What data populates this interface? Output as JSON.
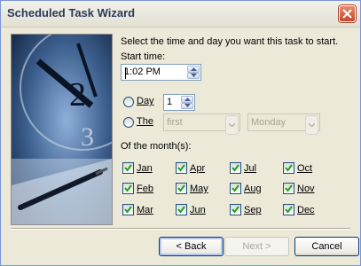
{
  "window": {
    "title": "Scheduled Task Wizard"
  },
  "instruction": "Select the time and day you want this task to start.",
  "start_time": {
    "label": "Start time:",
    "value": "1:02 PM"
  },
  "day_option": {
    "label": "Day",
    "value": "1"
  },
  "the_option": {
    "label": "The",
    "week_value": "first",
    "weekday_value": "Monday"
  },
  "months": {
    "label": "Of the month(s):",
    "items": [
      {
        "label": "Jan",
        "checked": true
      },
      {
        "label": "Apr",
        "checked": true
      },
      {
        "label": "Jul",
        "checked": true
      },
      {
        "label": "Oct",
        "checked": true
      },
      {
        "label": "Feb",
        "checked": true
      },
      {
        "label": "May",
        "checked": true
      },
      {
        "label": "Aug",
        "checked": true
      },
      {
        "label": "Nov",
        "checked": true
      },
      {
        "label": "Mar",
        "checked": true
      },
      {
        "label": "Jun",
        "checked": true
      },
      {
        "label": "Sep",
        "checked": true
      },
      {
        "label": "Dec",
        "checked": true
      }
    ]
  },
  "buttons": {
    "back": "< Back",
    "next": "Next >",
    "cancel": "Cancel"
  },
  "icons": {
    "close": "close-icon",
    "art": "clock-and-pen-illustration"
  }
}
